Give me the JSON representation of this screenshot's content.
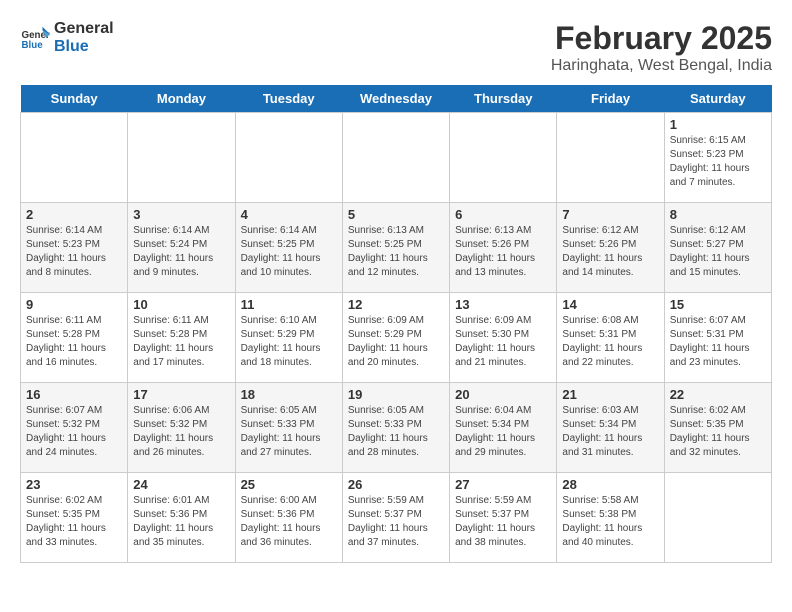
{
  "logo": {
    "general": "General",
    "blue": "Blue"
  },
  "title": "February 2025",
  "subtitle": "Haringhata, West Bengal, India",
  "headers": [
    "Sunday",
    "Monday",
    "Tuesday",
    "Wednesday",
    "Thursday",
    "Friday",
    "Saturday"
  ],
  "weeks": [
    [
      {
        "day": "",
        "info": ""
      },
      {
        "day": "",
        "info": ""
      },
      {
        "day": "",
        "info": ""
      },
      {
        "day": "",
        "info": ""
      },
      {
        "day": "",
        "info": ""
      },
      {
        "day": "",
        "info": ""
      },
      {
        "day": "1",
        "info": "Sunrise: 6:15 AM\nSunset: 5:23 PM\nDaylight: 11 hours\nand 7 minutes."
      }
    ],
    [
      {
        "day": "2",
        "info": "Sunrise: 6:14 AM\nSunset: 5:23 PM\nDaylight: 11 hours\nand 8 minutes."
      },
      {
        "day": "3",
        "info": "Sunrise: 6:14 AM\nSunset: 5:24 PM\nDaylight: 11 hours\nand 9 minutes."
      },
      {
        "day": "4",
        "info": "Sunrise: 6:14 AM\nSunset: 5:25 PM\nDaylight: 11 hours\nand 10 minutes."
      },
      {
        "day": "5",
        "info": "Sunrise: 6:13 AM\nSunset: 5:25 PM\nDaylight: 11 hours\nand 12 minutes."
      },
      {
        "day": "6",
        "info": "Sunrise: 6:13 AM\nSunset: 5:26 PM\nDaylight: 11 hours\nand 13 minutes."
      },
      {
        "day": "7",
        "info": "Sunrise: 6:12 AM\nSunset: 5:26 PM\nDaylight: 11 hours\nand 14 minutes."
      },
      {
        "day": "8",
        "info": "Sunrise: 6:12 AM\nSunset: 5:27 PM\nDaylight: 11 hours\nand 15 minutes."
      }
    ],
    [
      {
        "day": "9",
        "info": "Sunrise: 6:11 AM\nSunset: 5:28 PM\nDaylight: 11 hours\nand 16 minutes."
      },
      {
        "day": "10",
        "info": "Sunrise: 6:11 AM\nSunset: 5:28 PM\nDaylight: 11 hours\nand 17 minutes."
      },
      {
        "day": "11",
        "info": "Sunrise: 6:10 AM\nSunset: 5:29 PM\nDaylight: 11 hours\nand 18 minutes."
      },
      {
        "day": "12",
        "info": "Sunrise: 6:09 AM\nSunset: 5:29 PM\nDaylight: 11 hours\nand 20 minutes."
      },
      {
        "day": "13",
        "info": "Sunrise: 6:09 AM\nSunset: 5:30 PM\nDaylight: 11 hours\nand 21 minutes."
      },
      {
        "day": "14",
        "info": "Sunrise: 6:08 AM\nSunset: 5:31 PM\nDaylight: 11 hours\nand 22 minutes."
      },
      {
        "day": "15",
        "info": "Sunrise: 6:07 AM\nSunset: 5:31 PM\nDaylight: 11 hours\nand 23 minutes."
      }
    ],
    [
      {
        "day": "16",
        "info": "Sunrise: 6:07 AM\nSunset: 5:32 PM\nDaylight: 11 hours\nand 24 minutes."
      },
      {
        "day": "17",
        "info": "Sunrise: 6:06 AM\nSunset: 5:32 PM\nDaylight: 11 hours\nand 26 minutes."
      },
      {
        "day": "18",
        "info": "Sunrise: 6:05 AM\nSunset: 5:33 PM\nDaylight: 11 hours\nand 27 minutes."
      },
      {
        "day": "19",
        "info": "Sunrise: 6:05 AM\nSunset: 5:33 PM\nDaylight: 11 hours\nand 28 minutes."
      },
      {
        "day": "20",
        "info": "Sunrise: 6:04 AM\nSunset: 5:34 PM\nDaylight: 11 hours\nand 29 minutes."
      },
      {
        "day": "21",
        "info": "Sunrise: 6:03 AM\nSunset: 5:34 PM\nDaylight: 11 hours\nand 31 minutes."
      },
      {
        "day": "22",
        "info": "Sunrise: 6:02 AM\nSunset: 5:35 PM\nDaylight: 11 hours\nand 32 minutes."
      }
    ],
    [
      {
        "day": "23",
        "info": "Sunrise: 6:02 AM\nSunset: 5:35 PM\nDaylight: 11 hours\nand 33 minutes."
      },
      {
        "day": "24",
        "info": "Sunrise: 6:01 AM\nSunset: 5:36 PM\nDaylight: 11 hours\nand 35 minutes."
      },
      {
        "day": "25",
        "info": "Sunrise: 6:00 AM\nSunset: 5:36 PM\nDaylight: 11 hours\nand 36 minutes."
      },
      {
        "day": "26",
        "info": "Sunrise: 5:59 AM\nSunset: 5:37 PM\nDaylight: 11 hours\nand 37 minutes."
      },
      {
        "day": "27",
        "info": "Sunrise: 5:59 AM\nSunset: 5:37 PM\nDaylight: 11 hours\nand 38 minutes."
      },
      {
        "day": "28",
        "info": "Sunrise: 5:58 AM\nSunset: 5:38 PM\nDaylight: 11 hours\nand 40 minutes."
      },
      {
        "day": "",
        "info": ""
      }
    ]
  ]
}
